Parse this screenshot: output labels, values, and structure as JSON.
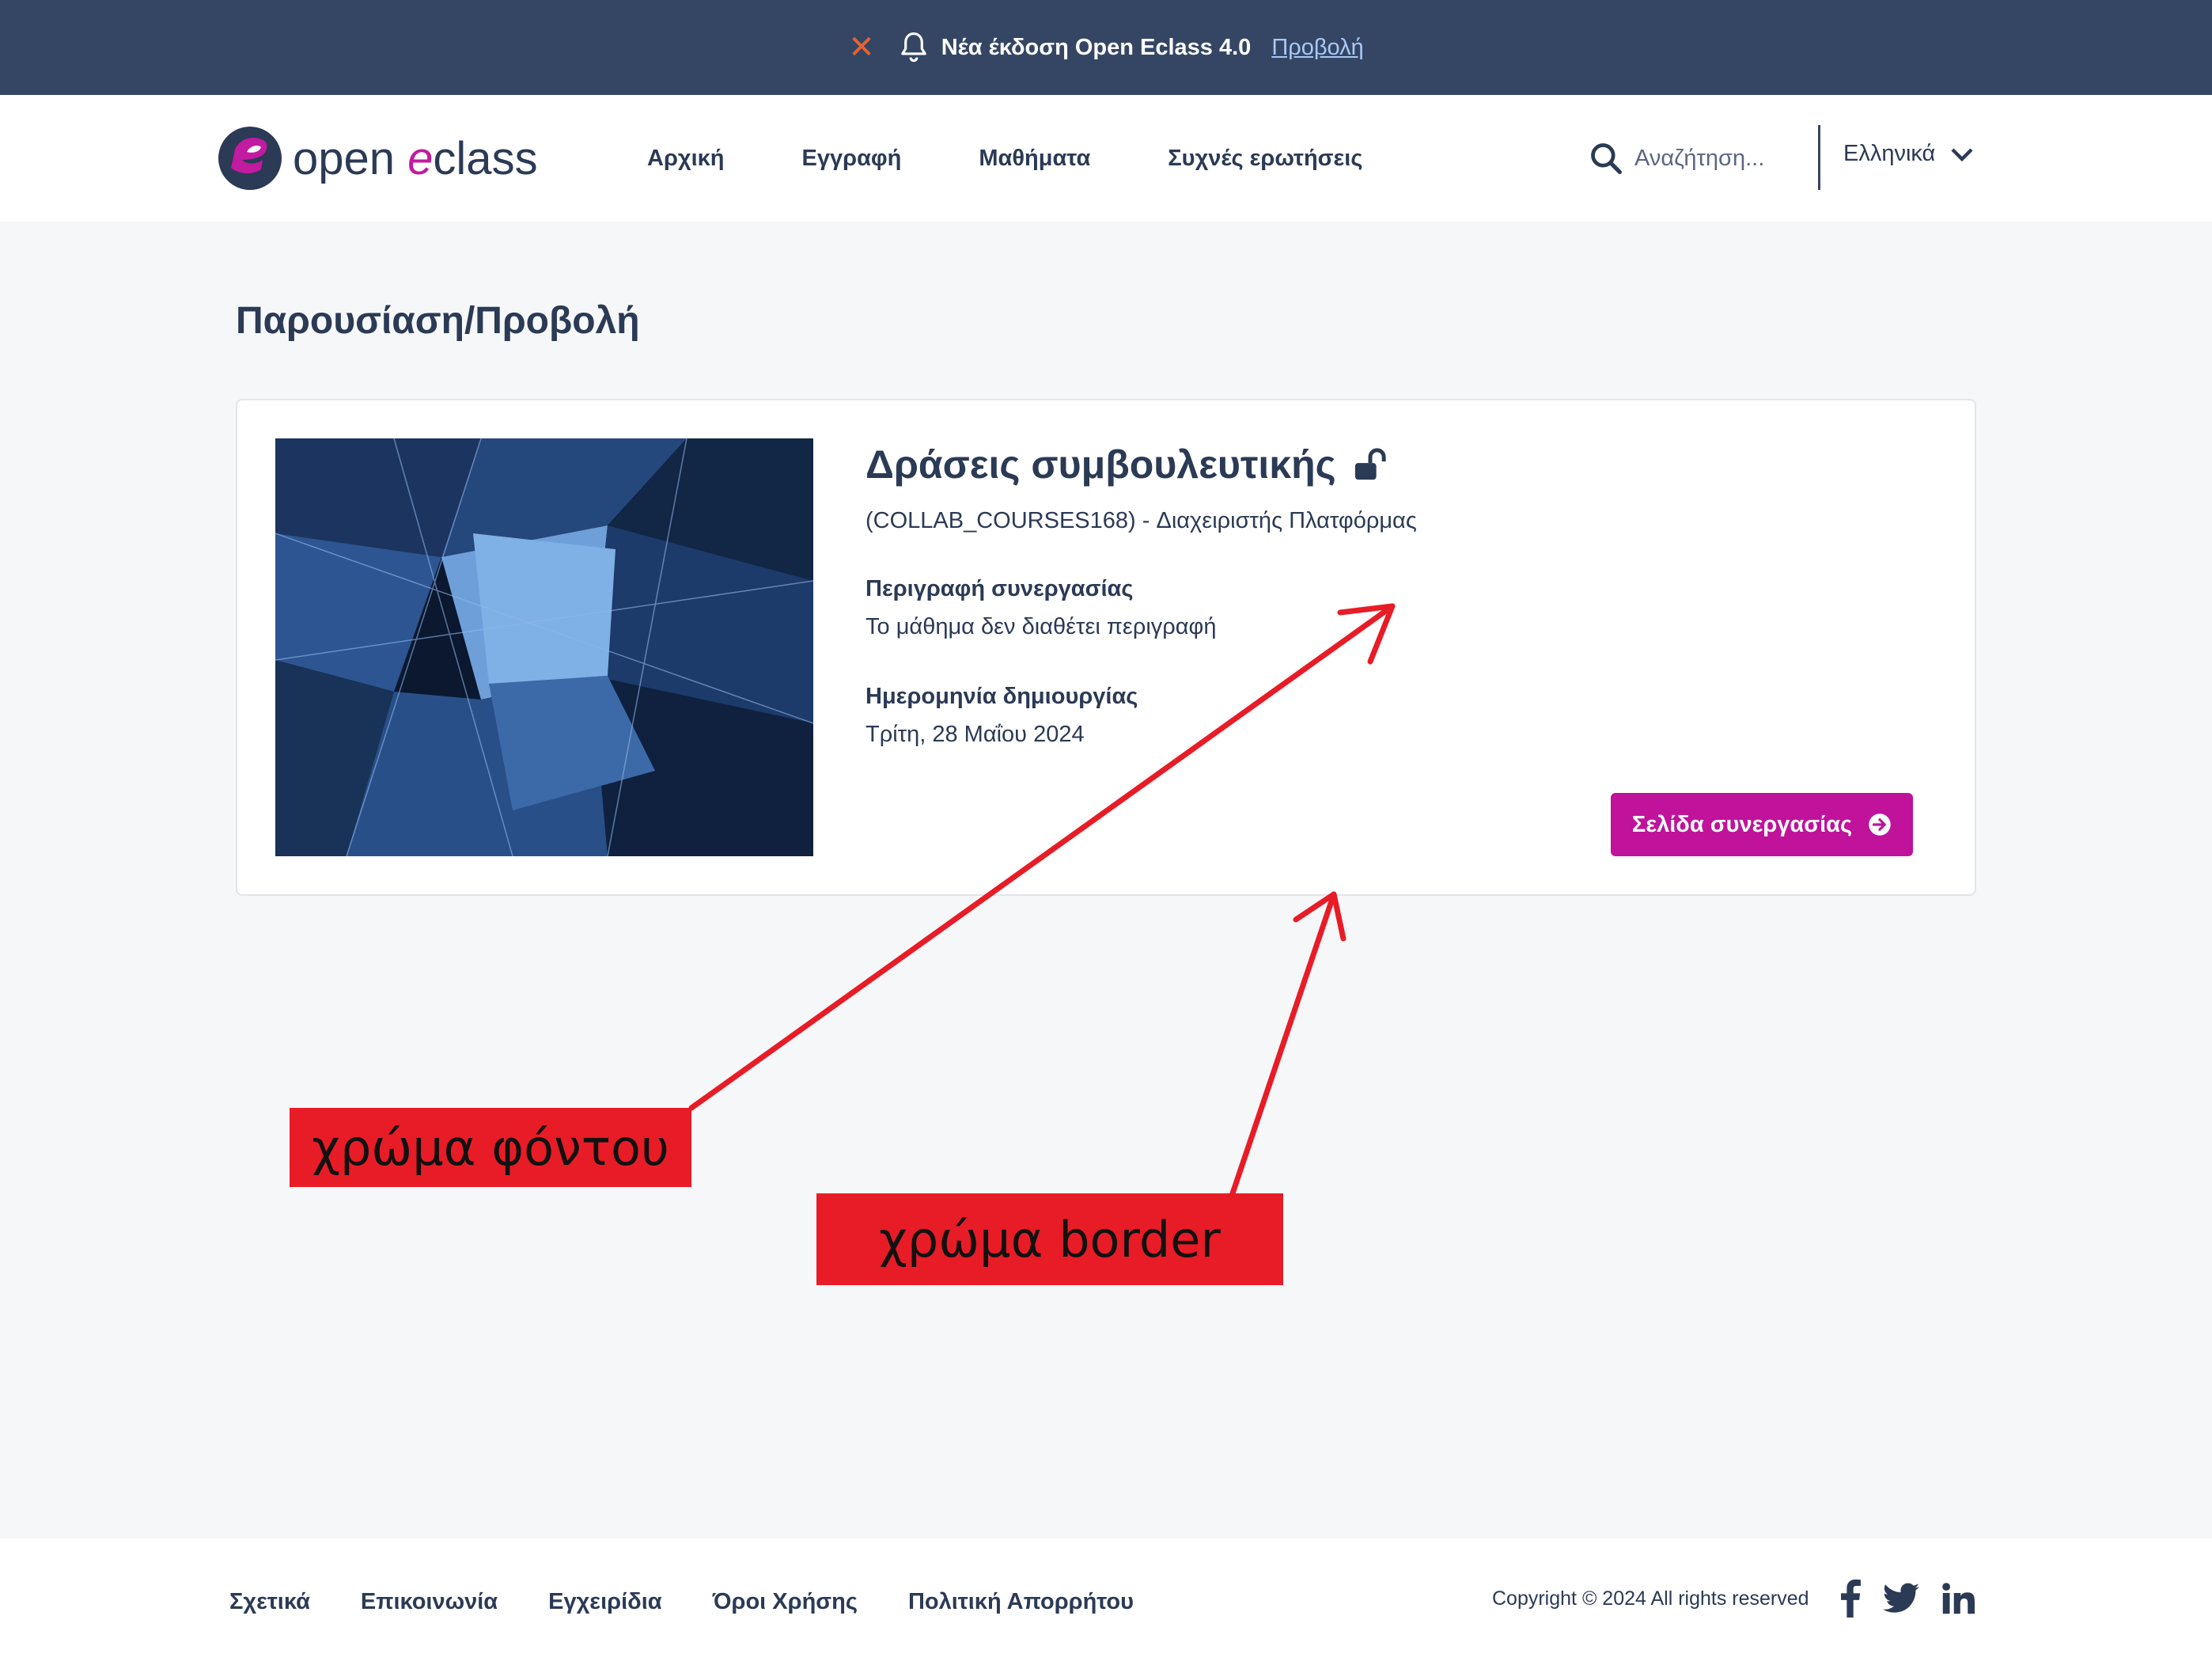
{
  "announcement": {
    "close_icon": "x-icon",
    "bell_icon": "bell-icon",
    "text": "Νέα έκδοση Open Eclass 4.0",
    "link": "Προβολή",
    "accent_color": "#e8622f"
  },
  "header": {
    "logo_word_1": "open ",
    "logo_word_2": "e",
    "logo_word_3": "class",
    "nav": [
      {
        "label": "Αρχική"
      },
      {
        "label": "Εγγραφή"
      },
      {
        "label": "Μαθήματα"
      },
      {
        "label": "Συχνές ερωτήσεις"
      }
    ],
    "search_placeholder": "Αναζήτηση...",
    "language": "Ελληνικά"
  },
  "page": {
    "title": "Παρουσίαση/Προβολή"
  },
  "course": {
    "title": "Δράσεις συμβουλευτικής",
    "code": "(COLLAB_COURSES168)",
    "separator": " - ",
    "admin": "Διαχειριστής Πλατφόρμας",
    "description_label": "Περιγραφή συνεργασίας",
    "description_value": "Το μάθημα δεν διαθέτει περιγραφή",
    "created_label": "Ημερομηνία δημιουργίας",
    "created_value": "Τρίτη, 28 Μαΐου 2024",
    "button_label": "Σελίδα συνεργασίας",
    "button_color": "#c0129b"
  },
  "annotations": {
    "background_label": "χρώμα φόντου",
    "border_label": "χρώμα border",
    "color": "#e81c26"
  },
  "footer": {
    "links": [
      {
        "label": "Σχετικά"
      },
      {
        "label": "Επικοινωνία"
      },
      {
        "label": "Εγχειρίδια"
      },
      {
        "label": "Όροι Χρήσης"
      },
      {
        "label": "Πολιτική Απορρήτου"
      }
    ],
    "copyright": "Copyright © 2024 All rights reserved",
    "socials": [
      "facebook-icon",
      "twitter-icon",
      "linkedin-icon"
    ]
  },
  "colors": {
    "topbar": "#344664",
    "text": "#2b3a55",
    "page_bg": "#f6f7f9"
  }
}
